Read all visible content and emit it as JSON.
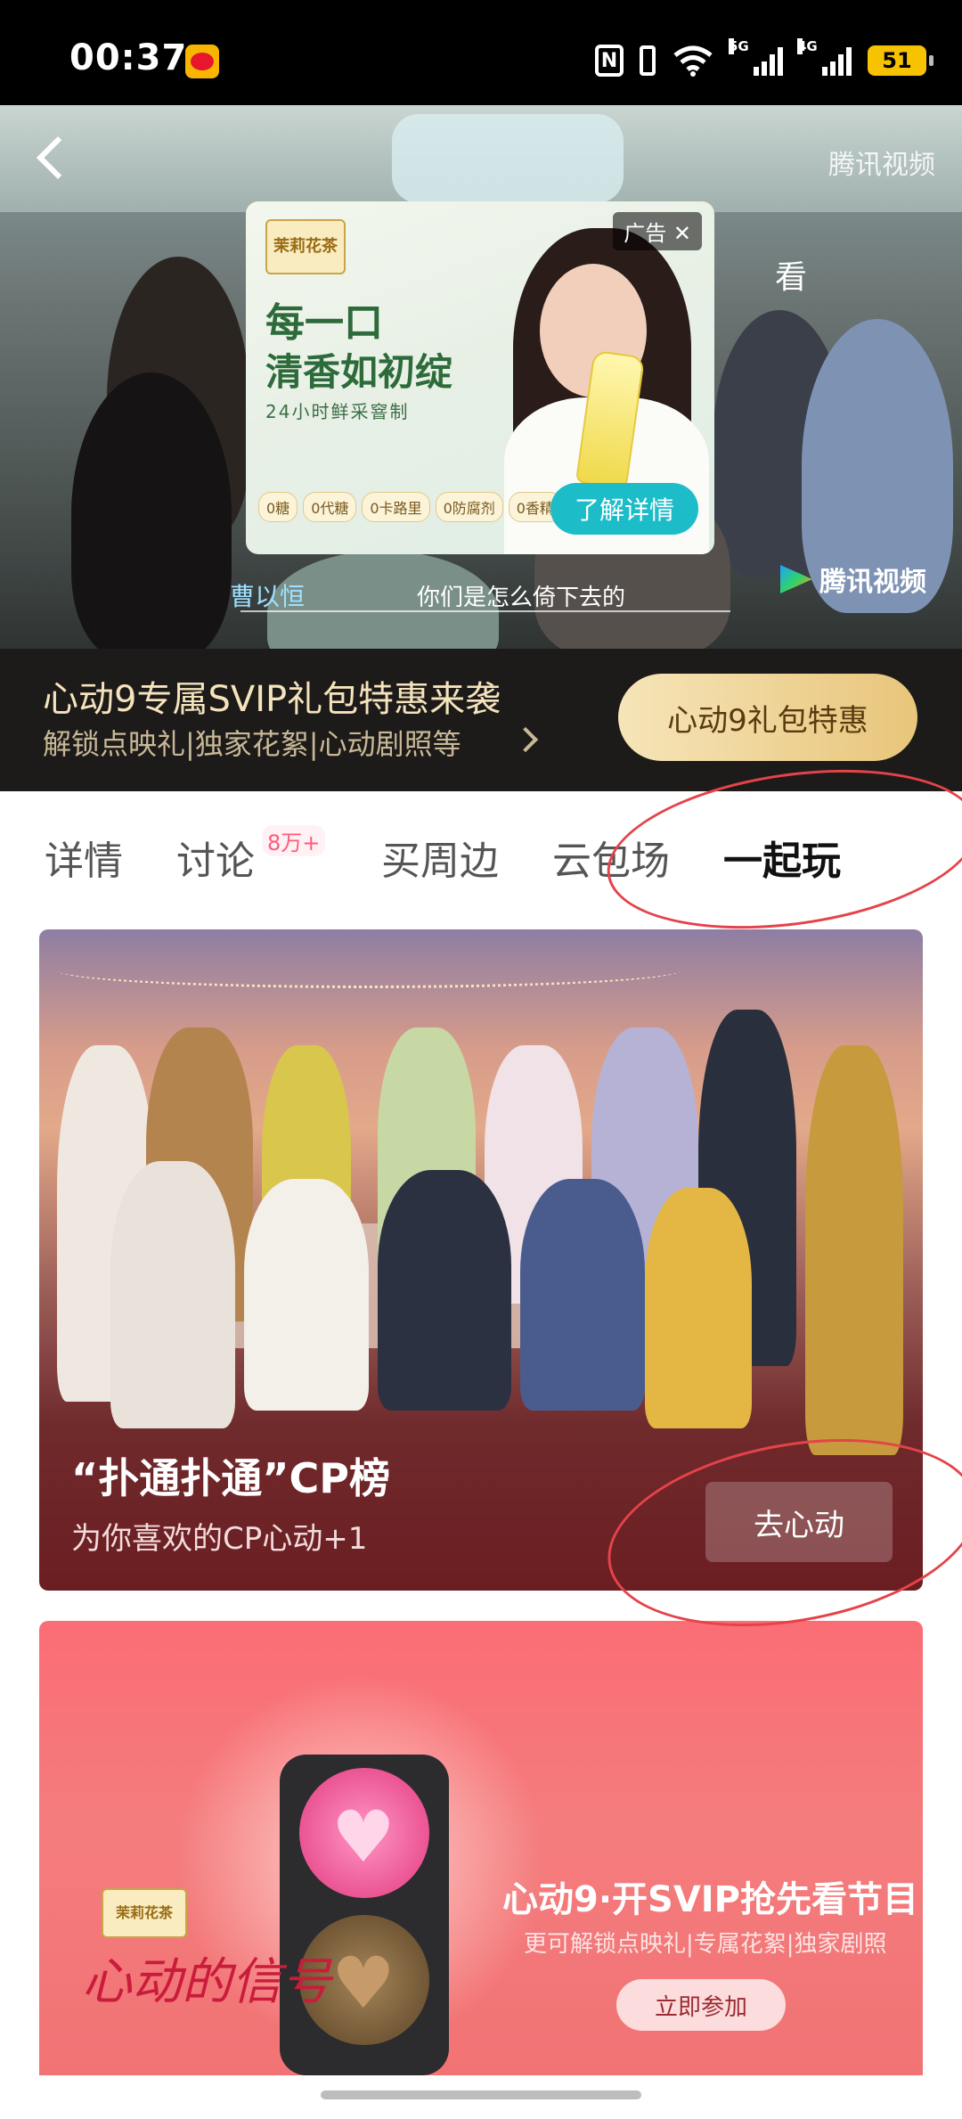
{
  "status_bar": {
    "time": "00:37",
    "nfc": "N",
    "net1": "5G",
    "net2": "4G",
    "battery": "51"
  },
  "video": {
    "watermark": "腾讯视频",
    "watermark_side": "看",
    "provider_logo": "腾讯视频",
    "name_caption": "曹以恒",
    "subtitle": "你们是怎么倚下去的"
  },
  "ad": {
    "brand": "茉莉花茶",
    "headline1": "每一口",
    "headline2": "清香如初绽",
    "headline3": "24小时鲜采窨制",
    "tag": "广告",
    "chips": [
      "0糖",
      "0代糖",
      "0卡路里",
      "0防腐剂",
      "0香精"
    ],
    "cta": "了解详情"
  },
  "svip_banner": {
    "title": "心动9专属SVIP礼包特惠来袭",
    "subtitle": "解锁点映礼|独家花絮|心动剧照等",
    "button": "心动9礼包特惠"
  },
  "tabs": {
    "items": [
      "详情",
      "讨论",
      "买周边",
      "云包场",
      "一起玩"
    ],
    "active": "一起玩",
    "discuss_badge": "8万+"
  },
  "cp_card": {
    "title": "“扑通扑通”CP榜",
    "subtitle": "为你喜欢的CP心动+1",
    "button": "去心动"
  },
  "svip_card": {
    "brand": "茉莉花茶",
    "logo_text": "心动的信号",
    "headline": "心动9·开SVIP抢先看节目",
    "subline": "更可解锁点映礼|专属花絮|独家剧照",
    "button": "立即参加"
  },
  "colors": {
    "annotation_red": "#e5434a",
    "gold_button": "#e8c57a",
    "ad_cta": "#1dbcc9"
  }
}
